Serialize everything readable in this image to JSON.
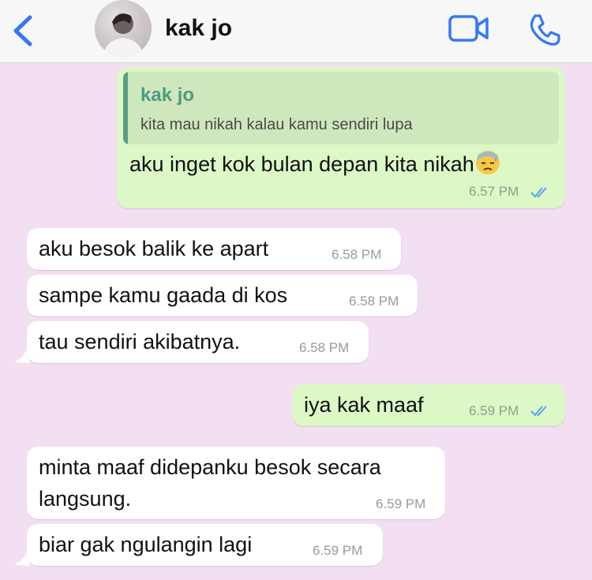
{
  "header": {
    "contact_name": "kak jo"
  },
  "icons": {
    "back": "chevron-left-icon",
    "video": "video-camera-icon",
    "call": "phone-icon",
    "read_receipt": "double-check-icon",
    "emoji": "downcast-face-with-sweat-emoji"
  },
  "colors": {
    "accent": "#3478f6",
    "outgoing_bubble": "#dcf8c6",
    "incoming_bubble": "#ffffff",
    "chat_background": "#f3dff2",
    "quote_name": "#4e9a84"
  },
  "messages": [
    {
      "direction": "outgoing",
      "reply_to": {
        "name": "kak jo",
        "text": "kita mau nikah kalau kamu sendiri lupa"
      },
      "text": "aku inget kok bulan depan kita nikah",
      "time": "6.57 PM",
      "read": true
    },
    {
      "direction": "incoming",
      "text": "aku besok balik ke apart",
      "time": "6.58 PM"
    },
    {
      "direction": "incoming",
      "text": "sampe kamu gaada di kos",
      "time": "6.58 PM"
    },
    {
      "direction": "incoming",
      "text": "tau sendiri akibatnya.",
      "time": "6.58 PM"
    },
    {
      "direction": "outgoing",
      "text": "iya kak maaf",
      "time": "6.59 PM",
      "read": true
    },
    {
      "direction": "incoming",
      "text_line1": "minta maaf didepanku besok secara",
      "text_line2": "langsung.",
      "time": "6.59 PM"
    },
    {
      "direction": "incoming",
      "text": "biar gak ngulangin lagi",
      "time": "6.59 PM"
    }
  ]
}
